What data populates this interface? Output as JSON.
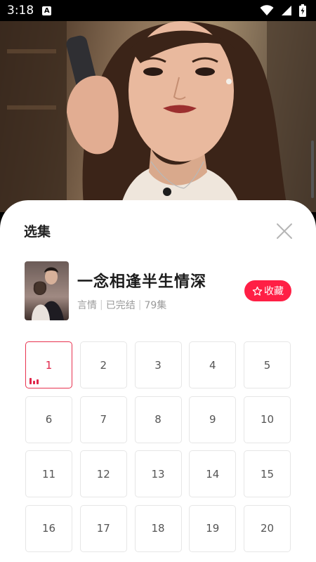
{
  "status": {
    "time": "3:18",
    "a_label": "A"
  },
  "sheet": {
    "title": "选集"
  },
  "drama": {
    "title": "一念相逢半生情深",
    "genre": "言情",
    "status": "已完结",
    "episodes_label": "79集",
    "cover_text": "一念相逢半生情深"
  },
  "favorite": {
    "label": "收藏"
  },
  "episodes": [
    "1",
    "2",
    "3",
    "4",
    "5",
    "6",
    "7",
    "8",
    "9",
    "10",
    "11",
    "12",
    "13",
    "14",
    "15",
    "16",
    "17",
    "18",
    "19",
    "20"
  ],
  "active_episode": "1",
  "colors": {
    "accent": "#ff1f45"
  }
}
